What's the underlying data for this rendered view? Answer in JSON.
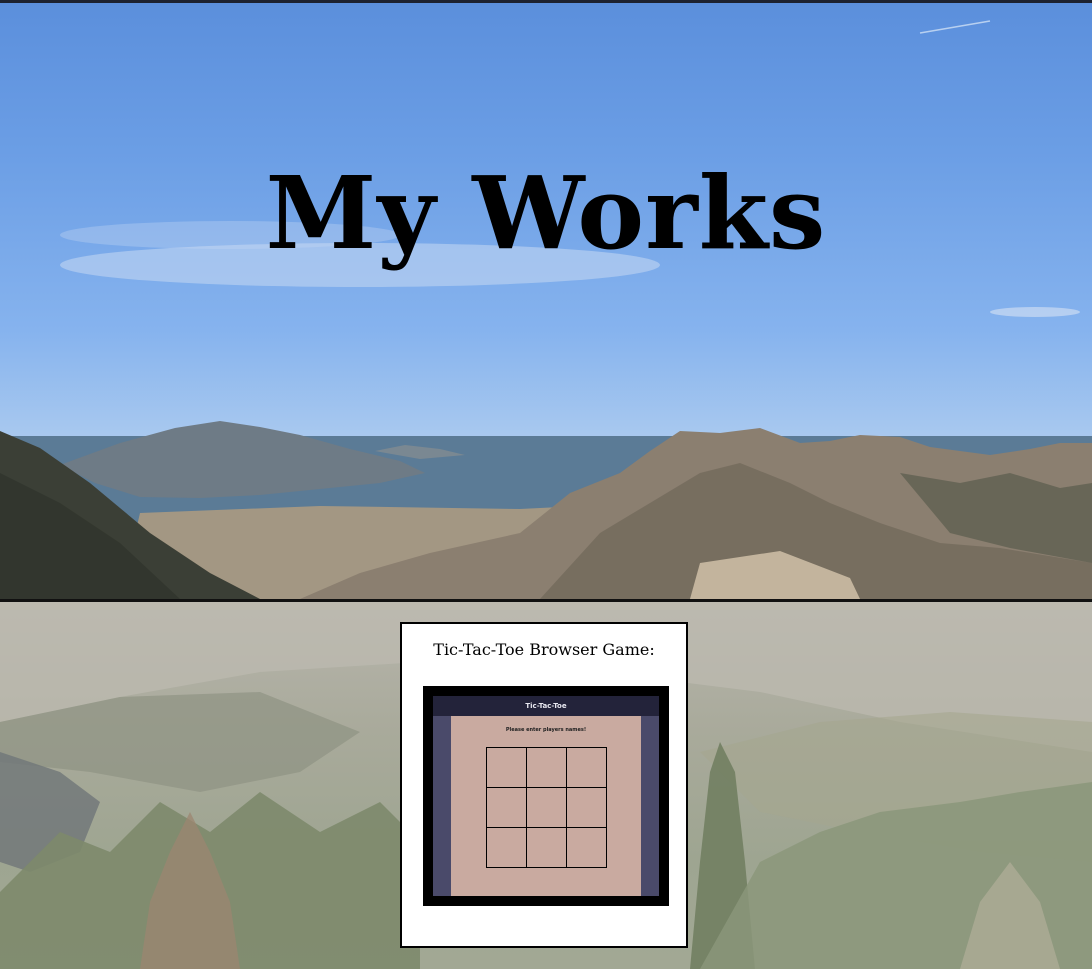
{
  "hero": {
    "title": "My Works"
  },
  "projects": [
    {
      "title": "Tic-Tac-Toe Browser Game:",
      "preview": {
        "header": "Tic-Tac-Toe",
        "prompt": "Please enter players names!",
        "board_cells": [
          "",
          "",
          "",
          "",
          "",
          "",
          "",
          "",
          ""
        ]
      }
    }
  ],
  "colors": {
    "title_text": "#000000",
    "card_background": "#ffffff",
    "preview_frame": "#000000",
    "preview_header": "#23233a",
    "preview_sidebar": "#4a4a6a",
    "preview_body": "#c9aaa0"
  }
}
